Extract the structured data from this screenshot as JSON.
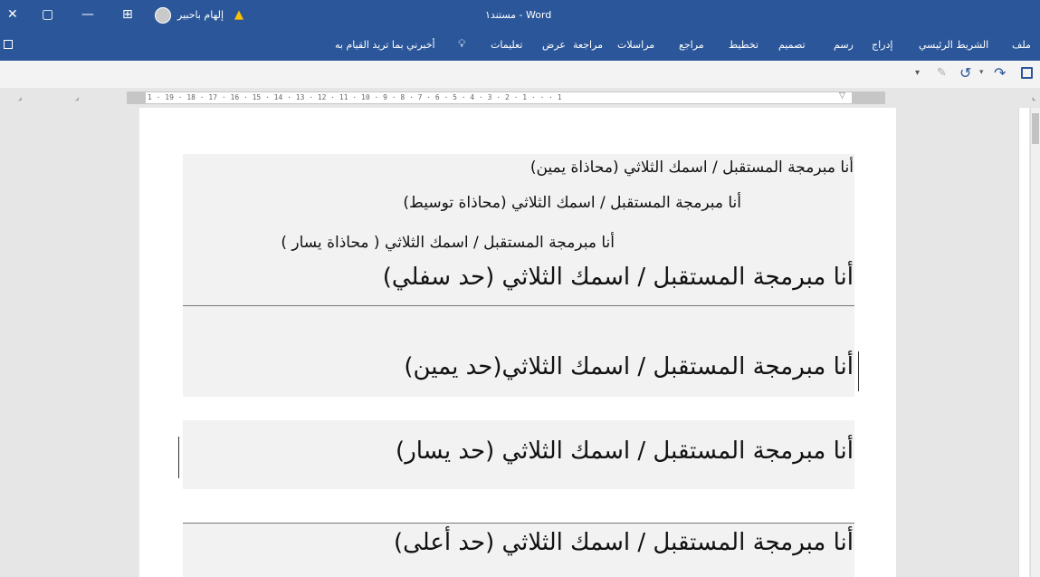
{
  "titlebar": {
    "title": "مستند١ - Word",
    "user": "إلهام باحبير",
    "warning_icon": "warning-icon",
    "controls": {
      "close": "✕",
      "restore": "▢",
      "minimize": "—",
      "ribbon_display": "⊞"
    }
  },
  "ribbon": {
    "tabs": [
      "ملف",
      "الشريط الرئيسي",
      "إدراج",
      "رسم",
      "تصميم",
      "تخطيط",
      "مراجع",
      "مراسلات",
      "مراجعة",
      "عرض",
      "تعليمات"
    ],
    "tell_me": "أخبرني بما تريد القيام به"
  },
  "qat": {
    "save_icon": "save-icon",
    "undo_icon": "undo-icon",
    "redo_icon": "redo-icon"
  },
  "ruler": {
    "ticks": "1 · 19 · 18 · 17 · 16 · 15 · 14 · 13 · 12 · 11 · 10 · 9 · 8 · 7 · 6 · 5 · 4 · 3 · 2 · 1 · · · 1"
  },
  "document": {
    "lines": [
      "أنا مبرمجة المستقبل / اسمك الثلاثي (محاذاة يمين)",
      "أنا مبرمجة المستقبل / اسمك الثلاثي (محاذاة توسيط)",
      "أنا مبرمجة المستقبل / اسمك الثلاثي ( محاذاة يسار )",
      "أنا مبرمجة المستقبل / اسمك الثلاثي (حد سفلي)",
      "أنا مبرمجة المستقبل / اسمك الثلاثي(حد يمين)",
      "أنا مبرمجة المستقبل / اسمك الثلاثي (حد يسار)",
      "أنا مبرمجة المستقبل / اسمك الثلاثي (حد أعلى)"
    ]
  },
  "colors": {
    "accent": "#2b579a",
    "page": "#ffffff",
    "shade": "#f2f2f2"
  }
}
